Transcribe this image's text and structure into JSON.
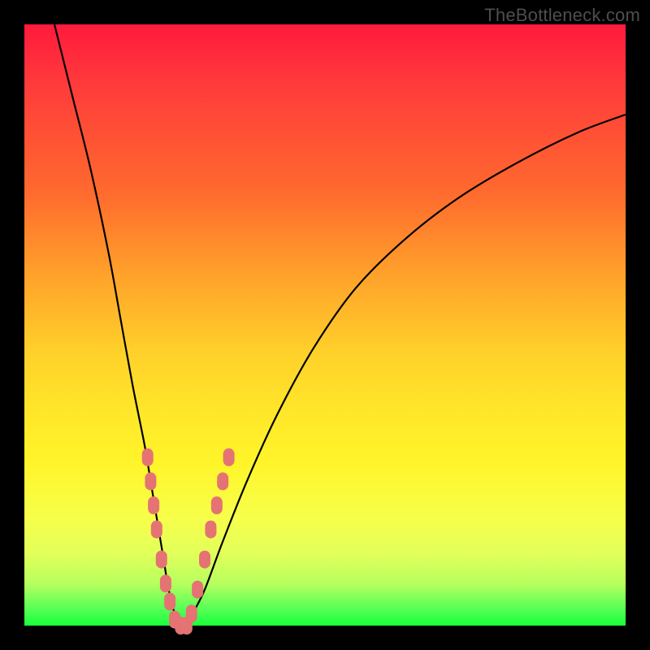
{
  "watermark": "TheBottleneck.com",
  "chart_data": {
    "type": "line",
    "title": "",
    "xlabel": "",
    "ylabel": "",
    "xlim": [
      0,
      100
    ],
    "ylim": [
      0,
      100
    ],
    "series": [
      {
        "name": "bottleneck-curve",
        "x": [
          5,
          8,
          11,
          14,
          16,
          18,
          20,
          21,
          22,
          23,
          24,
          25,
          26,
          27,
          28,
          30,
          33,
          37,
          42,
          48,
          55,
          63,
          72,
          82,
          92,
          100
        ],
        "y": [
          100,
          88,
          76,
          62,
          51,
          40,
          30,
          24,
          18,
          12,
          6,
          2,
          0,
          0,
          2,
          6,
          14,
          24,
          35,
          46,
          56,
          64,
          71,
          77,
          82,
          85
        ]
      }
    ],
    "markers": {
      "name": "highlight-beads",
      "color": "#e57373",
      "points": [
        {
          "x": 20.5,
          "y": 28
        },
        {
          "x": 21.0,
          "y": 24
        },
        {
          "x": 21.5,
          "y": 20
        },
        {
          "x": 22.0,
          "y": 16
        },
        {
          "x": 22.8,
          "y": 11
        },
        {
          "x": 23.5,
          "y": 7
        },
        {
          "x": 24.2,
          "y": 4
        },
        {
          "x": 25.0,
          "y": 1
        },
        {
          "x": 26.0,
          "y": 0
        },
        {
          "x": 27.0,
          "y": 0
        },
        {
          "x": 27.8,
          "y": 2
        },
        {
          "x": 28.8,
          "y": 6
        },
        {
          "x": 30.0,
          "y": 11
        },
        {
          "x": 31.0,
          "y": 16
        },
        {
          "x": 32.0,
          "y": 20
        },
        {
          "x": 33.0,
          "y": 24
        },
        {
          "x": 34.0,
          "y": 28
        }
      ]
    },
    "gradient_stops": [
      {
        "pos": 0,
        "color": "#ff1a3d"
      },
      {
        "pos": 28,
        "color": "#ff6a2e"
      },
      {
        "pos": 55,
        "color": "#ffd22a"
      },
      {
        "pos": 82,
        "color": "#f7ff4a"
      },
      {
        "pos": 100,
        "color": "#18ff3b"
      }
    ]
  }
}
